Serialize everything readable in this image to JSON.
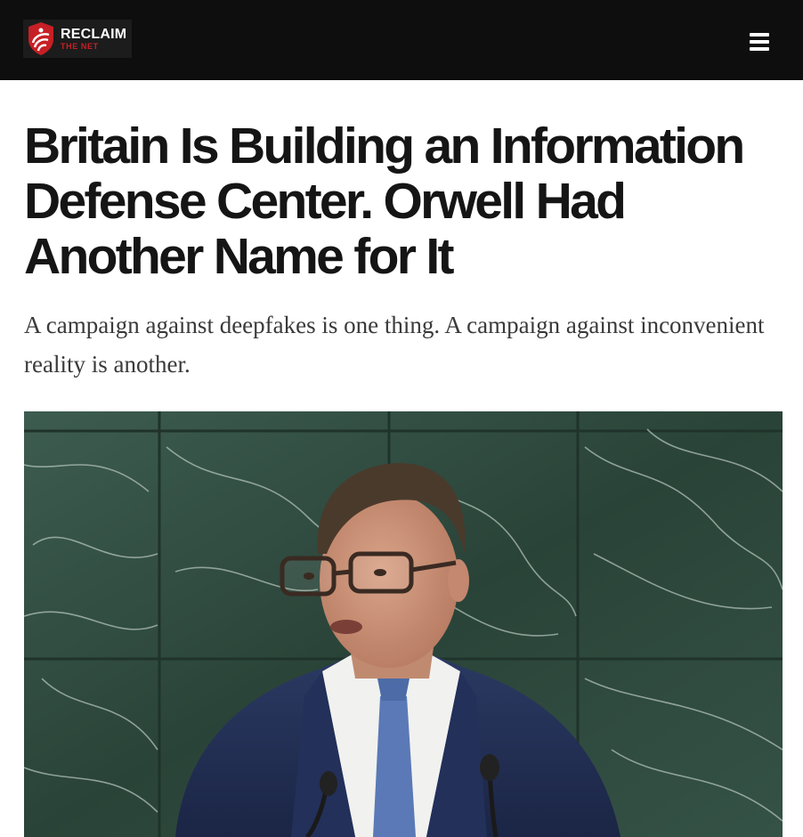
{
  "header": {
    "logo": {
      "name": "RECLAIM",
      "tagline": "THE NET"
    },
    "menu_icon": "hamburger-menu-icon"
  },
  "article": {
    "headline": "Britain Is Building an Information Defense Center. Orwell Had Another Name for It",
    "subheadline": "A campaign against deepfakes is one thing. A campaign against inconvenient reality is another."
  },
  "colors": {
    "topbar": "#0e0e0e",
    "brand_red": "#c62026",
    "headline": "#151515",
    "marble": "#2f4a3f"
  }
}
